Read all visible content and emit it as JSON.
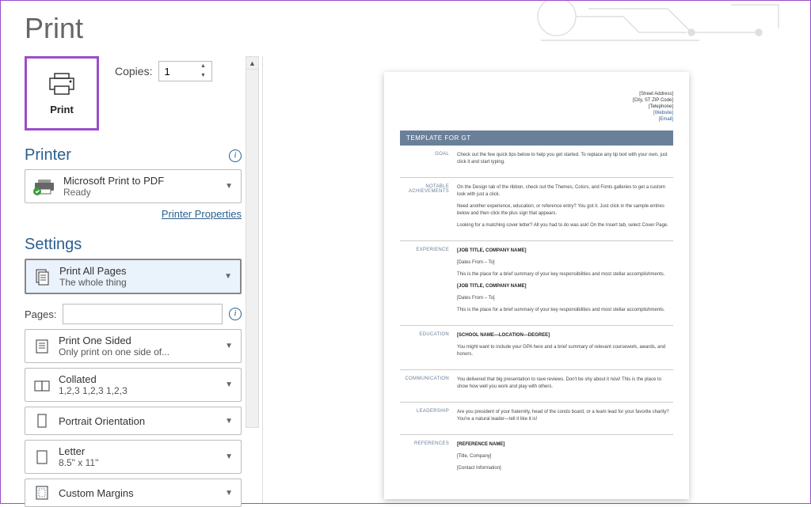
{
  "title": "Print",
  "printButton": {
    "label": "Print"
  },
  "copies": {
    "label": "Copies:",
    "value": "1"
  },
  "printer": {
    "sectionTitle": "Printer",
    "name": "Microsoft Print to PDF",
    "status": "Ready",
    "propertiesLink": "Printer Properties"
  },
  "settings": {
    "sectionTitle": "Settings",
    "pagesLabel": "Pages:",
    "pagesValue": "",
    "items": [
      {
        "icon": "pages-icon",
        "title": "Print All Pages",
        "sub": "The whole thing"
      },
      {
        "icon": "one-sided-icon",
        "title": "Print One Sided",
        "sub": "Only print on one side of..."
      },
      {
        "icon": "collated-icon",
        "title": "Collated",
        "sub": "1,2,3    1,2,3    1,2,3"
      },
      {
        "icon": "orientation-icon",
        "title": "Portrait Orientation",
        "sub": ""
      },
      {
        "icon": "paper-icon",
        "title": "Letter",
        "sub": "8.5\" x 11\""
      },
      {
        "icon": "margins-icon",
        "title": "Custom Margins",
        "sub": ""
      }
    ]
  },
  "preview": {
    "address": [
      "[Street Address]",
      "[City, ST ZIP Code]",
      "[Telephone]",
      "[Website]",
      "[Email]"
    ],
    "banner": "TEMPLATE FOR GT",
    "sections": [
      {
        "label": "GOAL",
        "body": [
          "Check out the few quick tips below to help you get started. To replace any tip text with your own, just click it and start typing."
        ]
      },
      {
        "label": "NOTABLE ACHIEVEMENTS",
        "body": [
          "On the Design tab of the ribbon, check out the Themes, Colors, and Fonts galleries to get a custom look with just a click.",
          "Need another experience, education, or reference entry? You got it. Just click in the sample entries below and then click the plus sign that appears.",
          "Looking for a matching cover letter? All you had to do was ask! On the Insert tab, select Cover Page."
        ]
      },
      {
        "label": "EXPERIENCE",
        "body": [
          "[JOB TITLE, COMPANY NAME]",
          "[Dates From – To]",
          "This is the place for a brief summary of your key responsibilities and most stellar accomplishments.",
          "[JOB TITLE, COMPANY NAME]",
          "[Dates From – To]",
          "This is the place for a brief summary of your key responsibilities and most stellar accomplishments."
        ]
      },
      {
        "label": "EDUCATION",
        "body": [
          "[SCHOOL NAME—LOCATION—DEGREE]",
          "You might want to include your GPA here and a brief summary of relevant coursework, awards, and honors."
        ]
      },
      {
        "label": "COMMUNICATION",
        "body": [
          "You delivered that big presentation to rave reviews. Don't be shy about it now! This is the place to show how well you work and play with others."
        ]
      },
      {
        "label": "LEADERSHIP",
        "body": [
          "Are you president of your fraternity, head of the condo board, or a team lead for your favorite charity? You're a natural leader—tell it like it is!"
        ]
      },
      {
        "label": "REFERENCES",
        "body": [
          "[REFERENCE NAME]",
          "[Title, Company]",
          "[Contact Information]"
        ]
      }
    ]
  }
}
